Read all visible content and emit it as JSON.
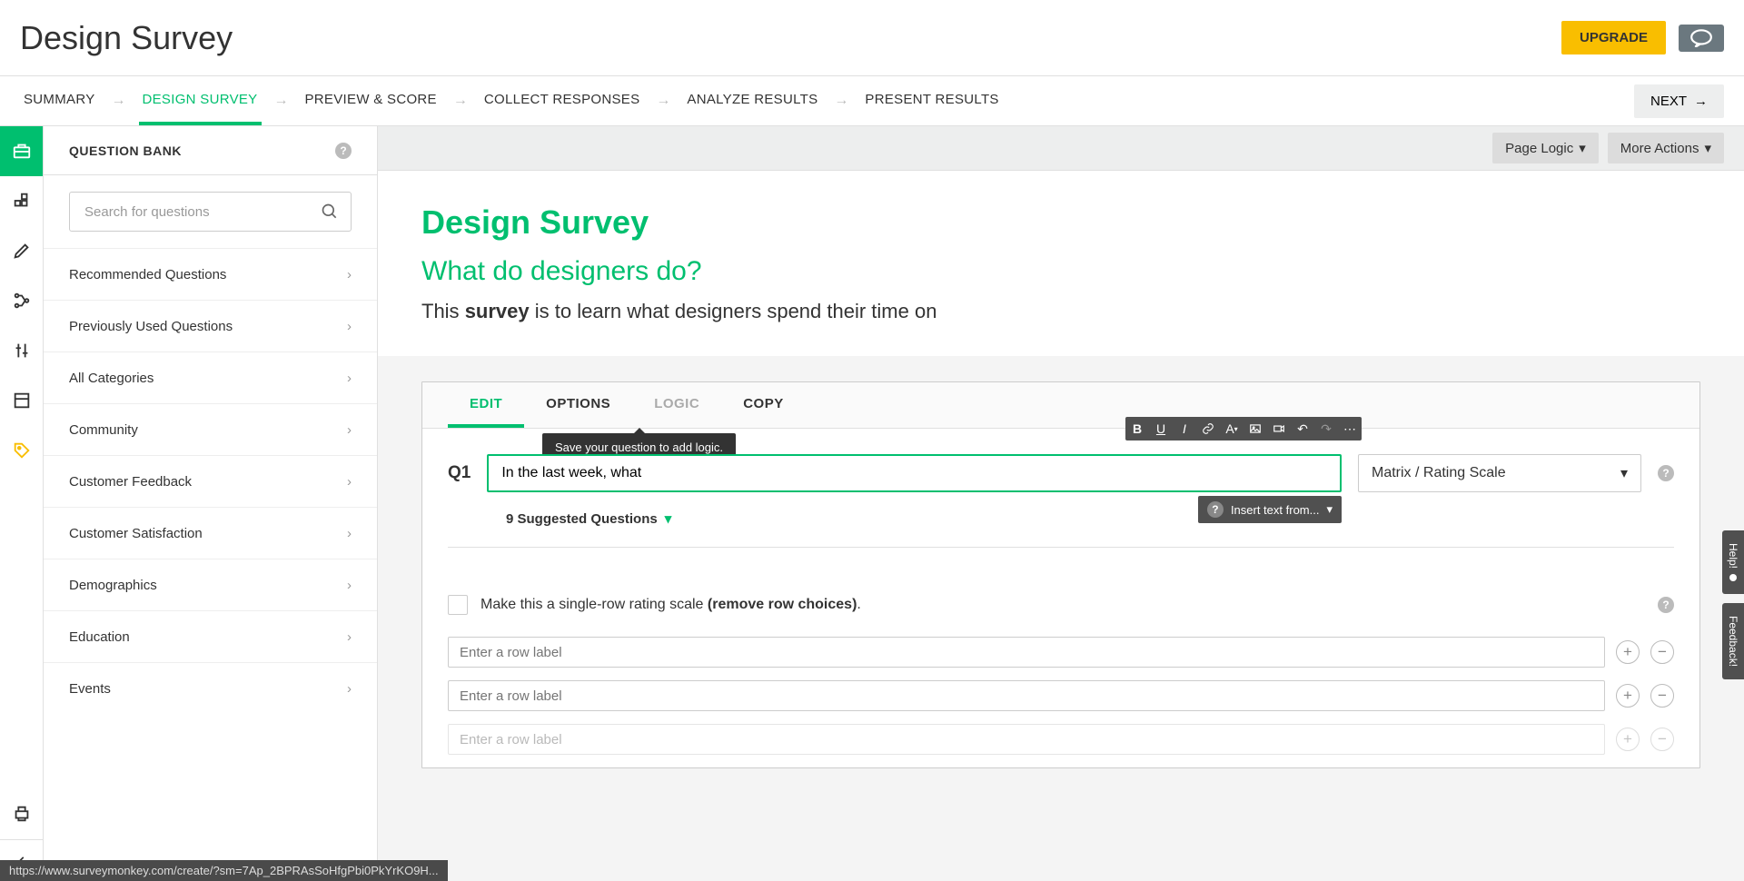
{
  "header": {
    "title": "Design Survey",
    "upgrade": "UPGRADE"
  },
  "nav": {
    "tabs": [
      "SUMMARY",
      "DESIGN SURVEY",
      "PREVIEW & SCORE",
      "COLLECT RESPONSES",
      "ANALYZE RESULTS",
      "PRESENT RESULTS"
    ],
    "activeIndex": 1,
    "next": "NEXT"
  },
  "sidebar": {
    "title": "QUESTION BANK",
    "searchPlaceholder": "Search for questions",
    "categories": [
      "Recommended Questions",
      "Previously Used Questions",
      "All Categories",
      "Community",
      "Customer Feedback",
      "Customer Satisfaction",
      "Demographics",
      "Education",
      "Events"
    ]
  },
  "pageTools": {
    "pageLogic": "Page Logic",
    "moreActions": "More Actions"
  },
  "survey": {
    "title": "Design Survey",
    "subtitle": "What do designers do?",
    "descPrefix": "This ",
    "descBold": "survey",
    "descSuffix": " is to learn what designers spend their time on"
  },
  "editor": {
    "tabs": {
      "edit": "EDIT",
      "options": "OPTIONS",
      "logic": "LOGIC",
      "copy": "COPY"
    },
    "tooltip": "Save your question to add logic.",
    "qnum": "Q1",
    "questionText": "In the last week, what",
    "questionType": "Matrix / Rating Scale",
    "insertFrom": "Insert text from...",
    "suggested": "9 Suggested Questions",
    "singleRowPrefix": "Make this a single-row rating scale ",
    "singleRowBold": "(remove row choices)",
    "singleRowSuffix": ".",
    "rowPlaceholder": "Enter a row label"
  },
  "sideTabs": {
    "help": "Help!",
    "feedback": "Feedback!"
  },
  "statusUrl": "https://www.surveymonkey.com/create/?sm=7Ap_2BPRAsSoHfgPbi0PkYrKO9H..."
}
